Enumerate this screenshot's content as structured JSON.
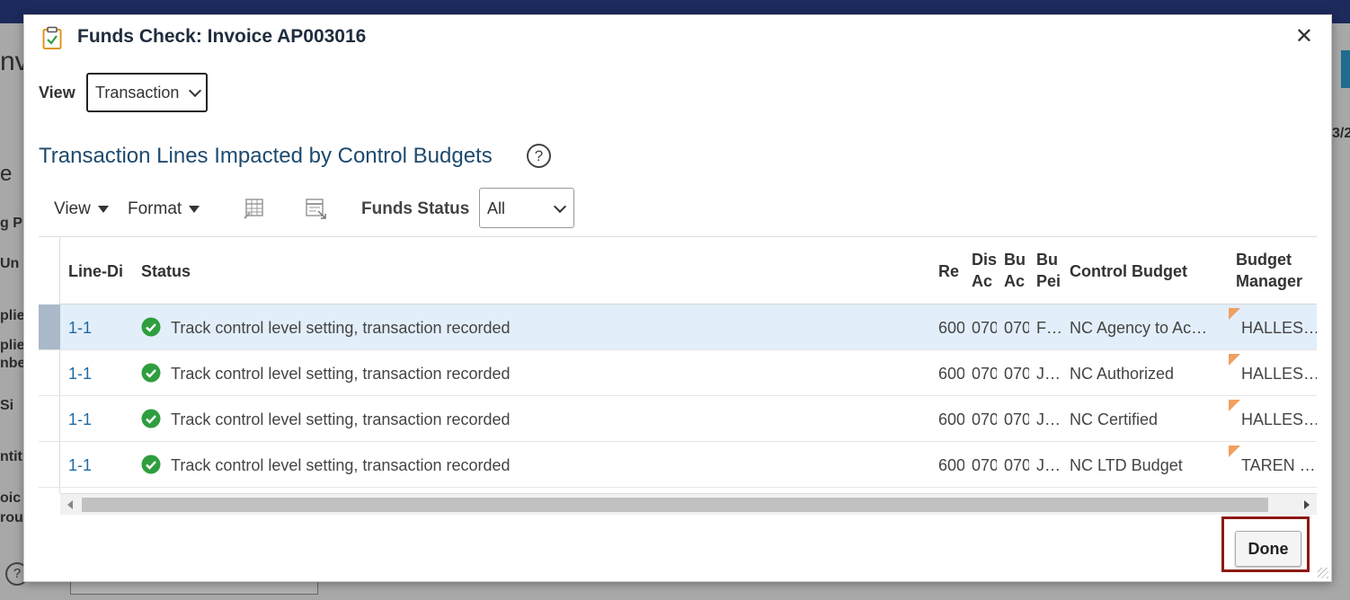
{
  "background": {
    "fragments": [
      "nv",
      "e",
      "g P",
      "Un",
      "plie",
      "plie",
      "nbe",
      "Si",
      "ntit",
      "oic",
      "rou",
      "3/2"
    ]
  },
  "dialog": {
    "title": "Funds Check: Invoice AP003016",
    "close_label": "✕",
    "view_label": "View",
    "view_value": "Transaction",
    "section_title": "Transaction Lines Impacted by Control Budgets",
    "help_label": "?",
    "toolbar": {
      "view_menu": "View",
      "format_menu": "Format",
      "funds_status_label": "Funds Status",
      "funds_status_value": "All"
    },
    "table": {
      "headers": {
        "line": "Line-Di",
        "status": "Status",
        "re": "Re",
        "dis1": "Dis",
        "dis2": "Ac",
        "bu1": "Bu",
        "bu2": "Ac",
        "bu3": "Bu",
        "bu4": "Pei",
        "control_budget": "Control Budget",
        "budget_manager1": "Budget",
        "budget_manager2": "Manager"
      },
      "rows": [
        {
          "line": "1-1",
          "status": "Track control level setting, transaction recorded",
          "re": "600",
          "dis": "070",
          "bu": "070",
          "per": "F…",
          "control_budget": "NC Agency to Ac…",
          "manager": "HALLES…"
        },
        {
          "line": "1-1",
          "status": "Track control level setting, transaction recorded",
          "re": "600",
          "dis": "070",
          "bu": "070",
          "per": "J…",
          "control_budget": "NC Authorized",
          "manager": "HALLES…"
        },
        {
          "line": "1-1",
          "status": "Track control level setting, transaction recorded",
          "re": "600",
          "dis": "070",
          "bu": "070",
          "per": "J…",
          "control_budget": "NC Certified",
          "manager": "HALLES…"
        },
        {
          "line": "1-1",
          "status": "Track control level setting, transaction recorded",
          "re": "600",
          "dis": "070",
          "bu": "070",
          "per": "J…",
          "control_budget": "NC LTD Budget",
          "manager": "TAREN …"
        }
      ]
    },
    "done_label": "Done"
  },
  "colors": {
    "link": "#1f6aa5",
    "success": "#2e9e3e",
    "selected_row": "#e2eef9",
    "highlight_border": "#8b1a12",
    "title_blue": "#1e4a6e"
  }
}
